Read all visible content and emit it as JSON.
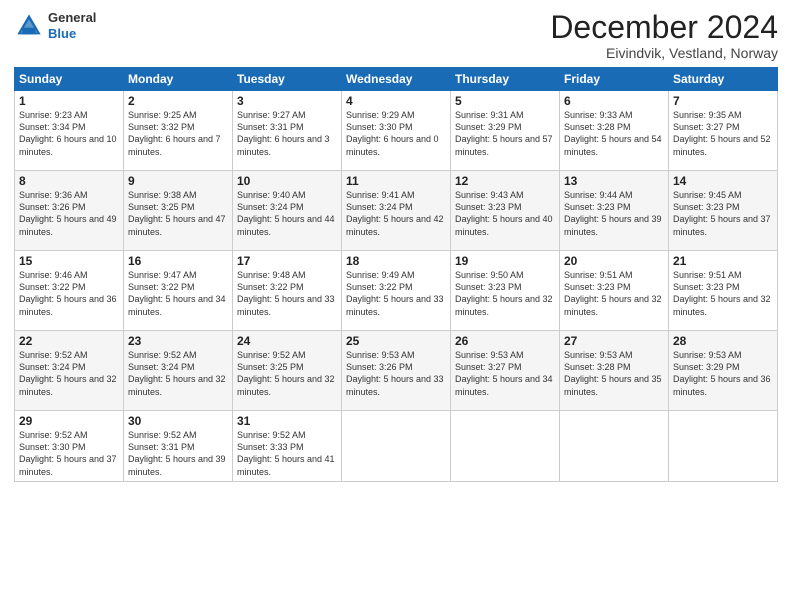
{
  "logo": {
    "general": "General",
    "blue": "Blue"
  },
  "header": {
    "month": "December 2024",
    "location": "Eivindvik, Vestland, Norway"
  },
  "weekdays": [
    "Sunday",
    "Monday",
    "Tuesday",
    "Wednesday",
    "Thursday",
    "Friday",
    "Saturday"
  ],
  "weeks": [
    [
      {
        "day": "1",
        "sunrise": "9:23 AM",
        "sunset": "3:34 PM",
        "daylight": "6 hours and 10 minutes."
      },
      {
        "day": "2",
        "sunrise": "9:25 AM",
        "sunset": "3:32 PM",
        "daylight": "6 hours and 7 minutes."
      },
      {
        "day": "3",
        "sunrise": "9:27 AM",
        "sunset": "3:31 PM",
        "daylight": "6 hours and 3 minutes."
      },
      {
        "day": "4",
        "sunrise": "9:29 AM",
        "sunset": "3:30 PM",
        "daylight": "6 hours and 0 minutes."
      },
      {
        "day": "5",
        "sunrise": "9:31 AM",
        "sunset": "3:29 PM",
        "daylight": "5 hours and 57 minutes."
      },
      {
        "day": "6",
        "sunrise": "9:33 AM",
        "sunset": "3:28 PM",
        "daylight": "5 hours and 54 minutes."
      },
      {
        "day": "7",
        "sunrise": "9:35 AM",
        "sunset": "3:27 PM",
        "daylight": "5 hours and 52 minutes."
      }
    ],
    [
      {
        "day": "8",
        "sunrise": "9:36 AM",
        "sunset": "3:26 PM",
        "daylight": "5 hours and 49 minutes."
      },
      {
        "day": "9",
        "sunrise": "9:38 AM",
        "sunset": "3:25 PM",
        "daylight": "5 hours and 47 minutes."
      },
      {
        "day": "10",
        "sunrise": "9:40 AM",
        "sunset": "3:24 PM",
        "daylight": "5 hours and 44 minutes."
      },
      {
        "day": "11",
        "sunrise": "9:41 AM",
        "sunset": "3:24 PM",
        "daylight": "5 hours and 42 minutes."
      },
      {
        "day": "12",
        "sunrise": "9:43 AM",
        "sunset": "3:23 PM",
        "daylight": "5 hours and 40 minutes."
      },
      {
        "day": "13",
        "sunrise": "9:44 AM",
        "sunset": "3:23 PM",
        "daylight": "5 hours and 39 minutes."
      },
      {
        "day": "14",
        "sunrise": "9:45 AM",
        "sunset": "3:23 PM",
        "daylight": "5 hours and 37 minutes."
      }
    ],
    [
      {
        "day": "15",
        "sunrise": "9:46 AM",
        "sunset": "3:22 PM",
        "daylight": "5 hours and 36 minutes."
      },
      {
        "day": "16",
        "sunrise": "9:47 AM",
        "sunset": "3:22 PM",
        "daylight": "5 hours and 34 minutes."
      },
      {
        "day": "17",
        "sunrise": "9:48 AM",
        "sunset": "3:22 PM",
        "daylight": "5 hours and 33 minutes."
      },
      {
        "day": "18",
        "sunrise": "9:49 AM",
        "sunset": "3:22 PM",
        "daylight": "5 hours and 33 minutes."
      },
      {
        "day": "19",
        "sunrise": "9:50 AM",
        "sunset": "3:23 PM",
        "daylight": "5 hours and 32 minutes."
      },
      {
        "day": "20",
        "sunrise": "9:51 AM",
        "sunset": "3:23 PM",
        "daylight": "5 hours and 32 minutes."
      },
      {
        "day": "21",
        "sunrise": "9:51 AM",
        "sunset": "3:23 PM",
        "daylight": "5 hours and 32 minutes."
      }
    ],
    [
      {
        "day": "22",
        "sunrise": "9:52 AM",
        "sunset": "3:24 PM",
        "daylight": "5 hours and 32 minutes."
      },
      {
        "day": "23",
        "sunrise": "9:52 AM",
        "sunset": "3:24 PM",
        "daylight": "5 hours and 32 minutes."
      },
      {
        "day": "24",
        "sunrise": "9:52 AM",
        "sunset": "3:25 PM",
        "daylight": "5 hours and 32 minutes."
      },
      {
        "day": "25",
        "sunrise": "9:53 AM",
        "sunset": "3:26 PM",
        "daylight": "5 hours and 33 minutes."
      },
      {
        "day": "26",
        "sunrise": "9:53 AM",
        "sunset": "3:27 PM",
        "daylight": "5 hours and 34 minutes."
      },
      {
        "day": "27",
        "sunrise": "9:53 AM",
        "sunset": "3:28 PM",
        "daylight": "5 hours and 35 minutes."
      },
      {
        "day": "28",
        "sunrise": "9:53 AM",
        "sunset": "3:29 PM",
        "daylight": "5 hours and 36 minutes."
      }
    ],
    [
      {
        "day": "29",
        "sunrise": "9:52 AM",
        "sunset": "3:30 PM",
        "daylight": "5 hours and 37 minutes."
      },
      {
        "day": "30",
        "sunrise": "9:52 AM",
        "sunset": "3:31 PM",
        "daylight": "5 hours and 39 minutes."
      },
      {
        "day": "31",
        "sunrise": "9:52 AM",
        "sunset": "3:33 PM",
        "daylight": "5 hours and 41 minutes."
      },
      null,
      null,
      null,
      null
    ]
  ]
}
